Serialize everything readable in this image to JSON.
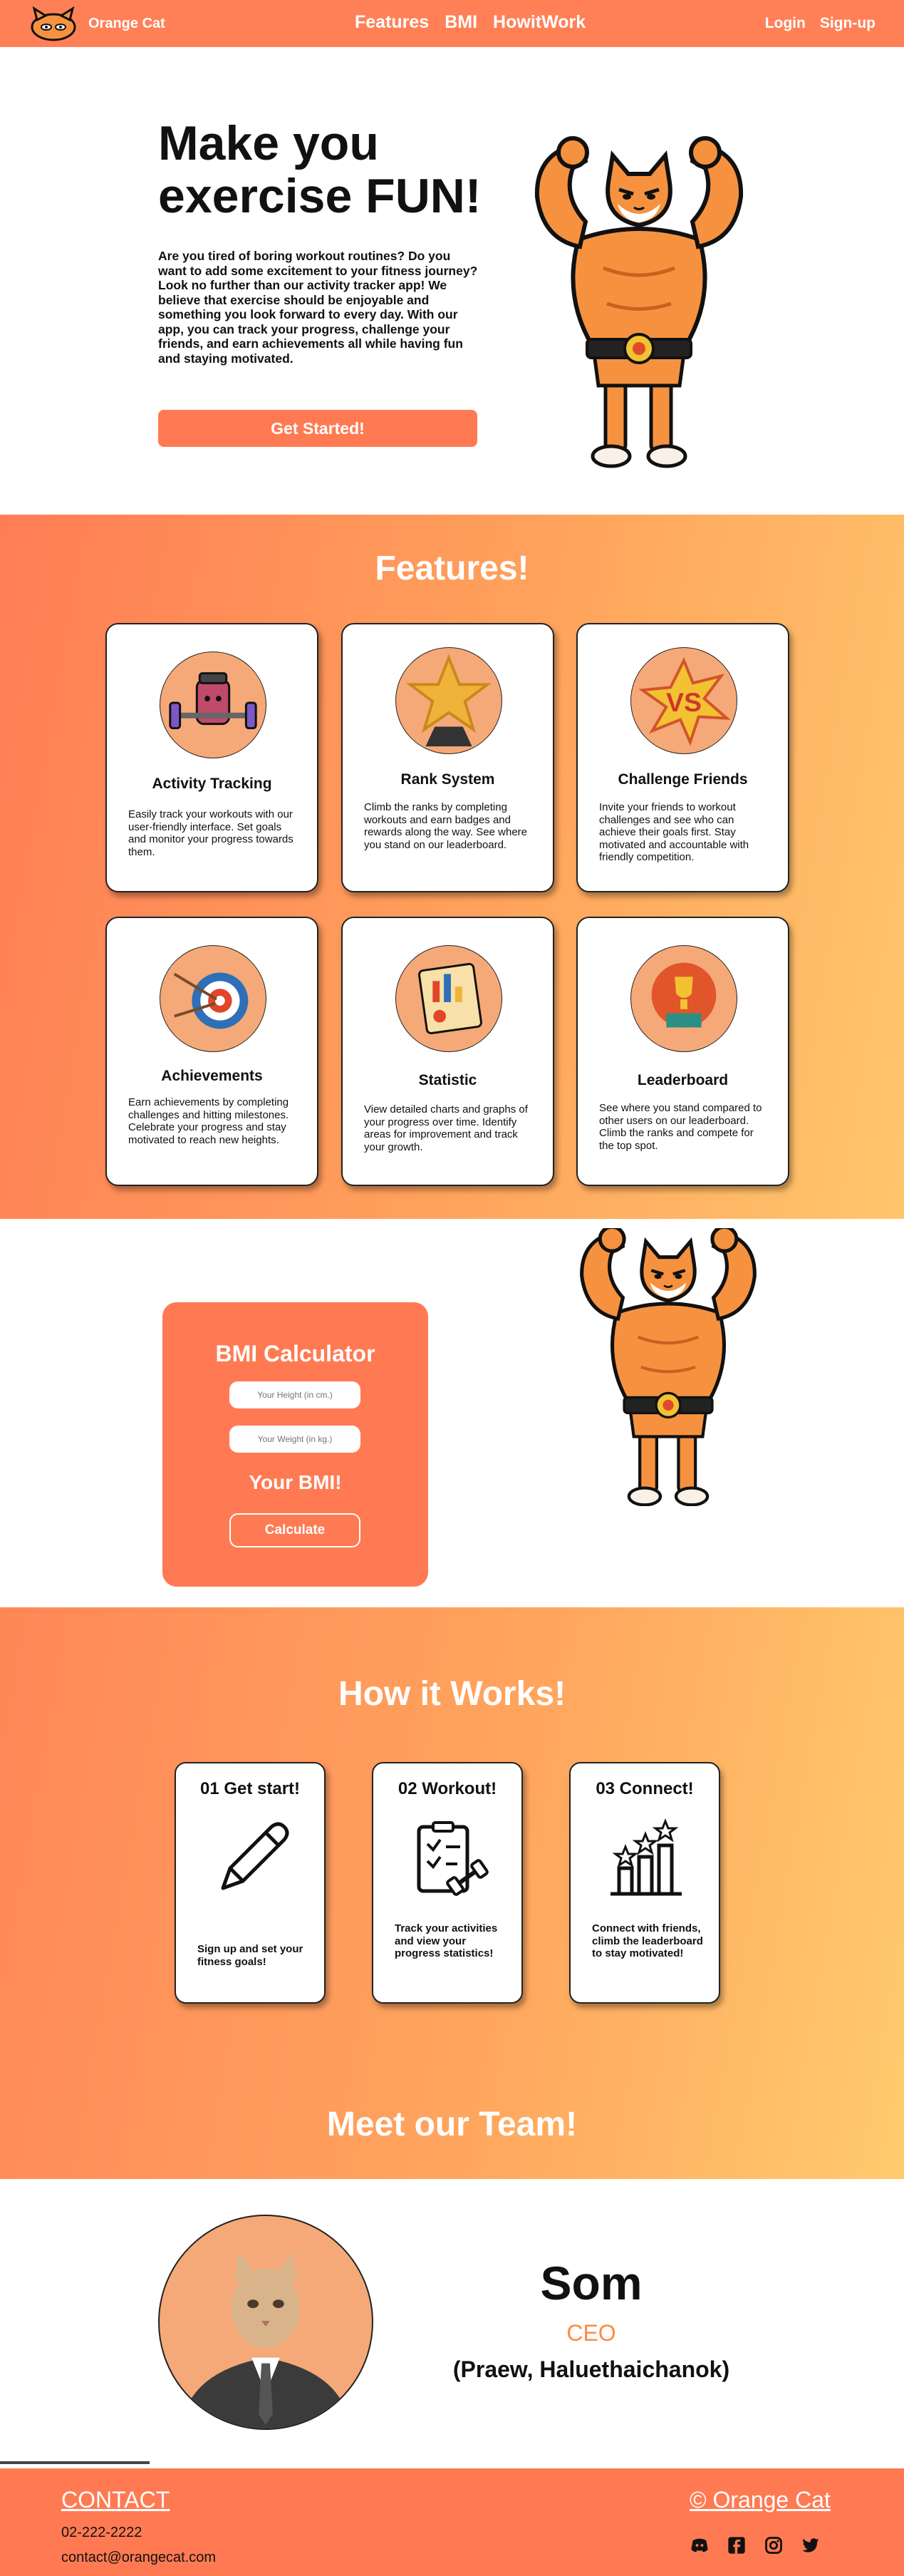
{
  "nav": {
    "brand": "Orange Cat",
    "links": [
      "Features",
      "BMI",
      "HowitWork"
    ],
    "login": "Login",
    "signup": "Sign-up"
  },
  "hero": {
    "title": "Make you exercise FUN!",
    "text": "Are you tired of boring workout routines? Do you want to add some excitement to your fitness journey? Look no further than our activity tracker app! We believe that exercise should be enjoyable and something you look forward to every day. With our app, you can track your progress, challenge your friends, and earn achievements all while having fun and staying motivated.",
    "cta": "Get Started!"
  },
  "features": {
    "title": "Features!",
    "cards": [
      {
        "title": "Activity Tracking",
        "icon": "dumbbell-jar-icon",
        "text": "Easily track your workouts with our user-friendly interface. Set goals and monitor your progress towards them."
      },
      {
        "title": "Rank System",
        "icon": "star-trophy-icon",
        "text": "Climb the ranks by completing workouts and earn badges and rewards along the way. See where you stand on our leaderboard."
      },
      {
        "title": "Challenge Friends",
        "icon": "versus-icon",
        "text": "Invite your friends to workout challenges and see who can achieve their goals first. Stay motivated and accountable with friendly competition."
      },
      {
        "title": "Achievements",
        "icon": "target-icon",
        "text": "Earn achievements by completing challenges and hitting milestones. Celebrate your progress and stay motivated to reach new heights."
      },
      {
        "title": "Statistic",
        "icon": "chart-board-icon",
        "text": "View detailed charts and graphs of your progress over time. Identify areas for improvement and track your growth."
      },
      {
        "title": "Leaderboard",
        "icon": "podium-trophy-icon",
        "text": "See where you stand compared to other users on our leaderboard. Climb the ranks and compete for the top spot."
      }
    ]
  },
  "bmi": {
    "title": "BMI Calculator",
    "height_placeholder": "Your Height (in cm.)",
    "weight_placeholder": "Your Weight (in kg.)",
    "result": "Your BMI!",
    "button": "Calculate"
  },
  "how": {
    "title": "How it Works!",
    "steps": [
      {
        "title": "01 Get start!",
        "icon": "pencil-icon",
        "text": "Sign up and set your fitness goals!"
      },
      {
        "title": "02 Workout!",
        "icon": "clipboard-dumbbell-icon",
        "text": "Track your activities and view your progress statistics!"
      },
      {
        "title": "03 Connect!",
        "icon": "star-bars-icon",
        "text": "Connect with friends, climb the leaderboard to stay motivated!"
      }
    ]
  },
  "team": {
    "title": "Meet our Team!",
    "name": "Som",
    "role": "CEO",
    "full_name": "(Praew, Haluethaichanok)"
  },
  "footer": {
    "contact": "CONTACT",
    "phone": "02-222-2222",
    "email": "contact@orangecat.com",
    "copyright": "© Orange Cat",
    "social": [
      "discord-icon",
      "facebook-icon",
      "instagram-icon",
      "twitter-icon"
    ]
  },
  "colors": {
    "accent": "#ff7a52",
    "gradient_start": "#ff7d55",
    "gradient_end": "#ffc66c",
    "role": "#ff8a42"
  }
}
